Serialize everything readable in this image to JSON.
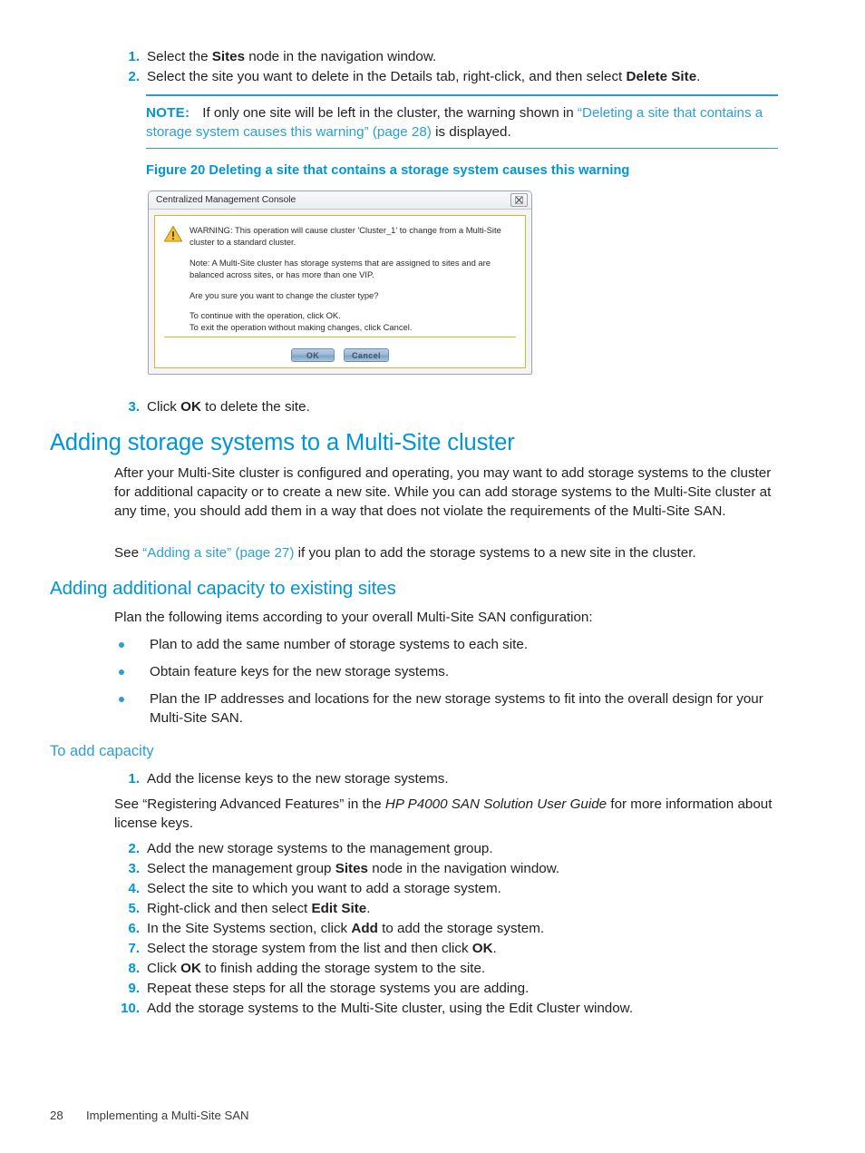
{
  "steps_delete": {
    "items": [
      {
        "num": "1.",
        "text_parts": [
          {
            "t": "Select the ",
            "style": "normal"
          },
          {
            "t": "Sites",
            "style": "bold"
          },
          {
            "t": " node in the navigation window.",
            "style": "normal"
          }
        ]
      },
      {
        "num": "2.",
        "text_parts": [
          {
            "t": "Select the site you want to delete in the Details tab, right-click, and then select ",
            "style": "normal"
          },
          {
            "t": "Delete Site",
            "style": "bold"
          },
          {
            "t": ".",
            "style": "normal"
          }
        ]
      }
    ]
  },
  "note": {
    "label": "NOTE:",
    "text_before": "If only one site will be left in the cluster, the warning shown in ",
    "link_text": "“Deleting a site that contains a storage system causes this warning” (page 28)",
    "text_after": " is displayed."
  },
  "figure": {
    "caption": "Figure 20 Deleting a site that contains a storage system causes this warning",
    "dialog": {
      "title": "Centralized Management Console",
      "close_glyph": "⌧",
      "warning_icon": "warning-triangle",
      "paragraphs": [
        "WARNING: This operation will cause cluster 'Cluster_1' to change from a Multi-Site cluster to a standard cluster.",
        "Note: A Multi-Site cluster has storage systems that are assigned to sites and are balanced across sites, or has more than one VIP.",
        "Are you sure you want to change the cluster type?",
        "To continue with the operation, click OK.",
        "To exit the operation without making changes, click Cancel."
      ],
      "buttons": {
        "ok": "OK",
        "cancel": "Cancel"
      }
    }
  },
  "step3": {
    "num": "3.",
    "parts": [
      {
        "t": "Click ",
        "style": "normal"
      },
      {
        "t": "OK",
        "style": "bold"
      },
      {
        "t": " to delete the site.",
        "style": "normal"
      }
    ]
  },
  "heading_main": "Adding storage systems to a Multi-Site cluster",
  "para_intro": "After your Multi-Site cluster is configured and operating, you may want to add storage systems to the cluster for additional capacity or to create a new site. While you can add storage systems to the Multi-Site cluster at any time, you should add them in a way that does not violate the requirements of the Multi-Site SAN.",
  "para_see": {
    "before": "See ",
    "link": "“Adding a site” (page 27)",
    "after": " if you plan to add the storage systems to a new site in the cluster."
  },
  "heading_sub": "Adding additional capacity to existing sites",
  "para_plan": "Plan the following items according to your overall Multi-Site SAN configuration:",
  "bullets": [
    "Plan to add the same number of storage systems to each site.",
    "Obtain feature keys for the new storage systems.",
    "Plan the IP addresses and locations for the new storage systems to fit into the overall design for your Multi-Site SAN."
  ],
  "heading_capacity": "To add capacity",
  "capacity_steps": [
    {
      "num": "1.",
      "parts": [
        {
          "t": "Add the license keys to the new storage systems.",
          "style": "normal"
        }
      ]
    },
    {
      "num": "2.",
      "parts": [
        {
          "t": "Add the new storage systems to the management group.",
          "style": "normal"
        }
      ]
    },
    {
      "num": "3.",
      "parts": [
        {
          "t": "Select the management group ",
          "style": "normal"
        },
        {
          "t": "Sites",
          "style": "bold"
        },
        {
          "t": " node in the navigation window.",
          "style": "normal"
        }
      ]
    },
    {
      "num": "4.",
      "parts": [
        {
          "t": "Select the site to which you want to add a storage system.",
          "style": "normal"
        }
      ]
    },
    {
      "num": "5.",
      "parts": [
        {
          "t": "Right-click and then select ",
          "style": "normal"
        },
        {
          "t": "Edit Site",
          "style": "bold"
        },
        {
          "t": ".",
          "style": "normal"
        }
      ]
    },
    {
      "num": "6.",
      "parts": [
        {
          "t": "In the Site Systems section, click ",
          "style": "normal"
        },
        {
          "t": "Add",
          "style": "bold"
        },
        {
          "t": " to add the storage system.",
          "style": "normal"
        }
      ]
    },
    {
      "num": "7.",
      "parts": [
        {
          "t": "Select the storage system from the list and then click ",
          "style": "normal"
        },
        {
          "t": "OK",
          "style": "bold"
        },
        {
          "t": ".",
          "style": "normal"
        }
      ]
    },
    {
      "num": "8.",
      "parts": [
        {
          "t": "Click ",
          "style": "normal"
        },
        {
          "t": "OK",
          "style": "bold"
        },
        {
          "t": " to finish adding the storage system to the site.",
          "style": "normal"
        }
      ]
    },
    {
      "num": "9.",
      "parts": [
        {
          "t": "Repeat these steps for all the storage systems you are adding.",
          "style": "normal"
        }
      ]
    },
    {
      "num": "10.",
      "parts": [
        {
          "t": "Add the storage systems to the Multi-Site cluster, using the Edit Cluster window.",
          "style": "normal"
        }
      ]
    }
  ],
  "license_note": {
    "before": "See “Registering Advanced Features” in the ",
    "italic": "HP P4000 SAN Solution User Guide",
    "after": " for more information about license keys."
  },
  "footer": {
    "page_number": "28",
    "chapter": "Implementing a Multi-Site SAN"
  },
  "colors": {
    "accent_blue": "#0096d6",
    "link_blue": "#2b9fd4",
    "body_text": "#231f20",
    "dialog_border_yellow": "#e0b52e"
  }
}
